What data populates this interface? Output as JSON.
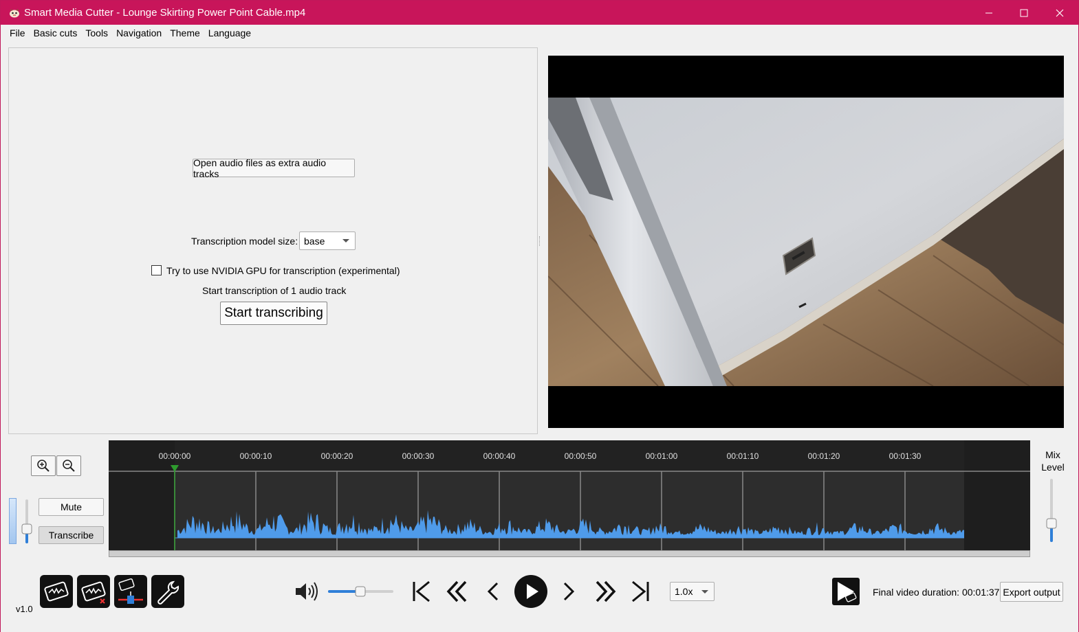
{
  "window": {
    "title": "Smart Media Cutter - Lounge Skirting Power Point Cable.mp4",
    "accent_color": "#c8155a",
    "controls": [
      "minimize-icon",
      "maximize-icon",
      "close-icon"
    ]
  },
  "menu": {
    "items": [
      {
        "label": "File"
      },
      {
        "label": "Basic cuts"
      },
      {
        "label": "Tools"
      },
      {
        "label": "Navigation"
      },
      {
        "label": "Theme"
      },
      {
        "label": "Language"
      }
    ]
  },
  "transcription_panel": {
    "open_audio_label": "Open audio files as extra audio tracks",
    "model_size_label": "Transcription model size:",
    "model_size_value": "base",
    "gpu_checkbox_label": "Try to use NVIDIA GPU for transcription (experimental)",
    "gpu_checked": false,
    "info_text": "Start transcription of 1 audio track",
    "start_button_label": "Start transcribing"
  },
  "track_controls": {
    "mute_label": "Mute",
    "transcribe_label": "Transcribe",
    "zoom_in_icon": "zoom-in-icon",
    "zoom_out_icon": "zoom-out-icon"
  },
  "timeline": {
    "tick_labels": [
      "00:00:00",
      "00:00:10",
      "00:00:20",
      "00:00:30",
      "00:00:40",
      "00:00:50",
      "00:01:00",
      "00:01:10",
      "00:01:20",
      "00:01:30"
    ],
    "waveform_color": "#4f9bea",
    "playhead_color": "#2e9b2e"
  },
  "mix": {
    "label_line1": "Mix",
    "label_line2": "Level"
  },
  "toolbar": {
    "speed_value": "1.0x",
    "final_duration_label": "Final video duration: 00:01:37",
    "export_label": "Export output",
    "version": "v1.0"
  }
}
